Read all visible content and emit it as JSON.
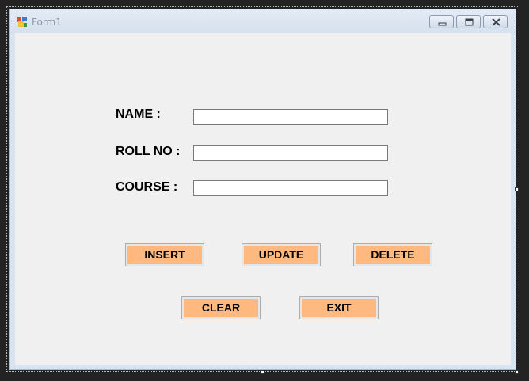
{
  "window": {
    "title": "Form1",
    "icon": "form-app-icon",
    "controls": [
      "minimize-icon",
      "maximize-icon",
      "close-icon"
    ]
  },
  "form": {
    "fields": [
      {
        "label": "NAME :",
        "value": ""
      },
      {
        "label": "ROLL NO :",
        "value": ""
      },
      {
        "label": "COURSE :",
        "value": ""
      }
    ],
    "buttons": {
      "insert": "INSERT",
      "update": "UPDATE",
      "delete": "DELETE",
      "clear": "CLEAR",
      "exit": "EXIT"
    }
  },
  "colors": {
    "button_face": "#fdb97f",
    "form_background": "#f0f0f0",
    "titlebar": "#dbe5f1"
  }
}
